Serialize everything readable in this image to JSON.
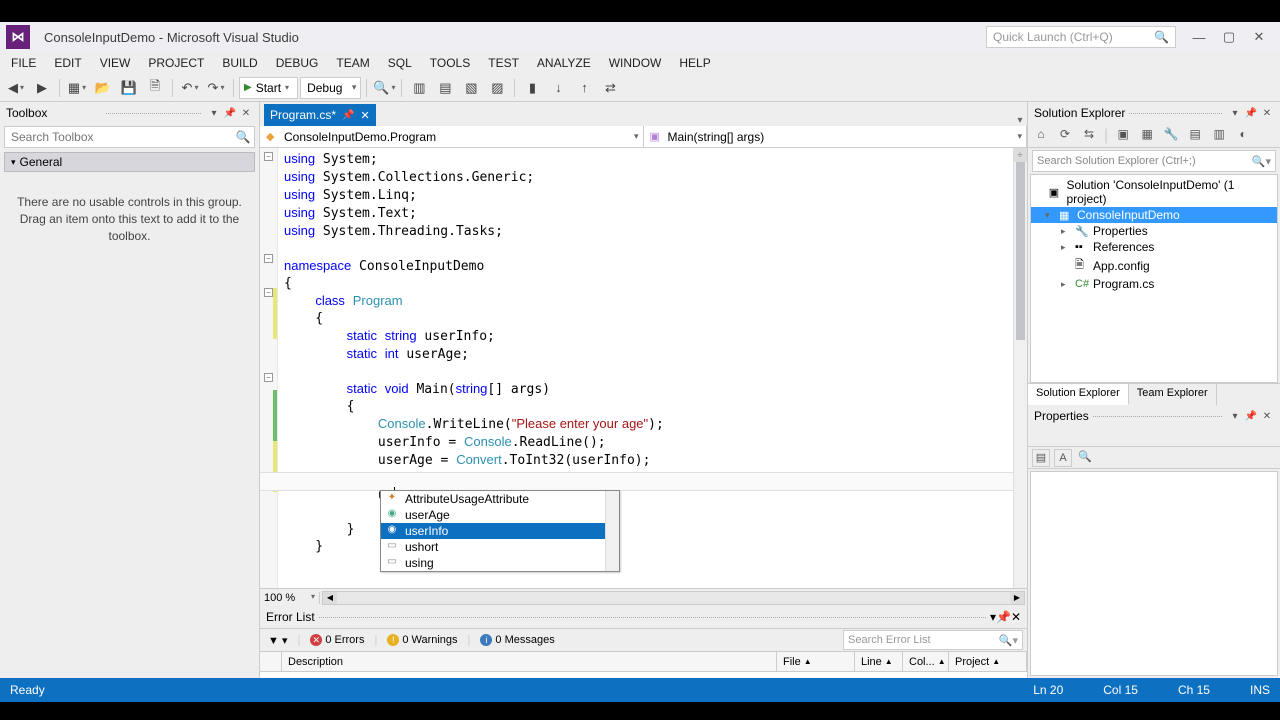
{
  "title": "ConsoleInputDemo - Microsoft Visual Studio",
  "quicklaunch_placeholder": "Quick Launch (Ctrl+Q)",
  "menu": [
    "FILE",
    "EDIT",
    "VIEW",
    "PROJECT",
    "BUILD",
    "DEBUG",
    "TEAM",
    "SQL",
    "TOOLS",
    "TEST",
    "ANALYZE",
    "WINDOW",
    "HELP"
  ],
  "toolbar": {
    "start": "Start",
    "config": "Debug"
  },
  "toolbox": {
    "title": "Toolbox",
    "search_placeholder": "Search Toolbox",
    "group": "General",
    "msg": "There are no usable controls in this group. Drag an item onto this text to add it to the toolbox."
  },
  "doctab": {
    "name": "Program.cs*"
  },
  "nav": {
    "left": "ConsoleInputDemo.Program",
    "right": "Main(string[] args)"
  },
  "intellisense": {
    "typed": "us",
    "items": [
      {
        "icon": "✦",
        "label": "AttributeUsageAttribute"
      },
      {
        "icon": "◉",
        "label": "userAge"
      },
      {
        "icon": "◉",
        "label": "userInfo",
        "selected": true
      },
      {
        "icon": "▭",
        "label": "ushort"
      },
      {
        "icon": "▭",
        "label": "using"
      }
    ]
  },
  "zoom": "100 %",
  "errorlist": {
    "title": "Error List",
    "errors": "0 Errors",
    "warnings": "0 Warnings",
    "messages": "0 Messages",
    "search_placeholder": "Search Error List",
    "cols": [
      "",
      "Description",
      "File",
      "Line",
      "Col...",
      "Project"
    ]
  },
  "solution": {
    "title": "Solution Explorer",
    "search_placeholder": "Search Solution Explorer (Ctrl+;)",
    "root": "Solution 'ConsoleInputDemo' (1 project)",
    "project": "ConsoleInputDemo",
    "nodes": [
      "Properties",
      "References",
      "App.config",
      "Program.cs"
    ],
    "tabs": [
      "Solution Explorer",
      "Team Explorer"
    ]
  },
  "properties": {
    "title": "Properties"
  },
  "status": {
    "ready": "Ready",
    "ln": "Ln 20",
    "col": "Col 15",
    "ch": "Ch 15",
    "ins": "INS"
  }
}
